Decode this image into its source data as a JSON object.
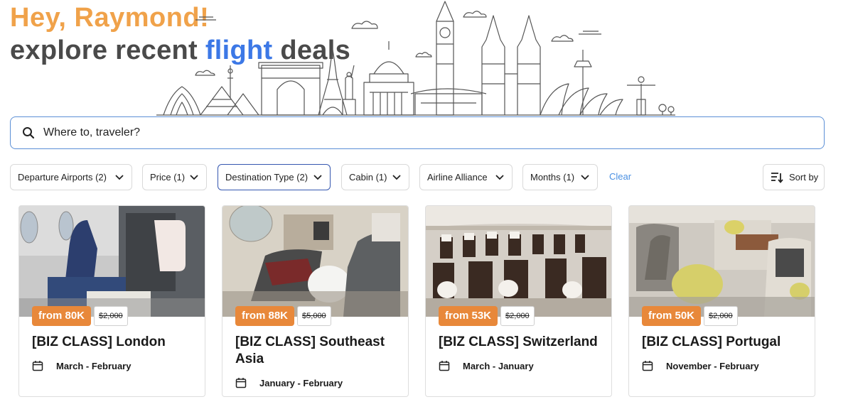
{
  "hero": {
    "greeting": "Hey, Raymond!",
    "headline_pre": "explore recent ",
    "headline_accent": "flight",
    "headline_post": " deals",
    "greeting_color": "#f0a24a",
    "accent_color": "#3c78e6"
  },
  "search": {
    "icon": "search-icon",
    "placeholder": "Where to, traveler?"
  },
  "filters": {
    "chips": [
      {
        "label": "Departure Airports (2)",
        "active": false
      },
      {
        "label": "Price (1)",
        "active": false
      },
      {
        "label": "Destination Type (2)",
        "active": true
      },
      {
        "label": "Cabin (1)",
        "active": false
      },
      {
        "label": "Airline Alliance",
        "active": false
      },
      {
        "label": "Months (1)",
        "active": false
      }
    ],
    "clear_label": "Clear",
    "sort_label": "Sort by",
    "active_border_color": "#3557b0"
  },
  "cards": [
    {
      "price": "from 80K",
      "was": "$2,000",
      "title": "[BIZ CLASS] London",
      "dates": "March - February"
    },
    {
      "price": "from 88K",
      "was": "$5,000",
      "title": "[BIZ CLASS] Southeast Asia",
      "dates": "January - February"
    },
    {
      "price": "from 53K",
      "was": "$2,000",
      "title": "[BIZ CLASS] Switzerland",
      "dates": "March - January"
    },
    {
      "price": "from 50K",
      "was": "$2,000",
      "title": "[BIZ CLASS] Portugal",
      "dates": "November - February"
    }
  ],
  "colors": {
    "price_badge": "#e8883a",
    "link": "#4a90e2"
  }
}
